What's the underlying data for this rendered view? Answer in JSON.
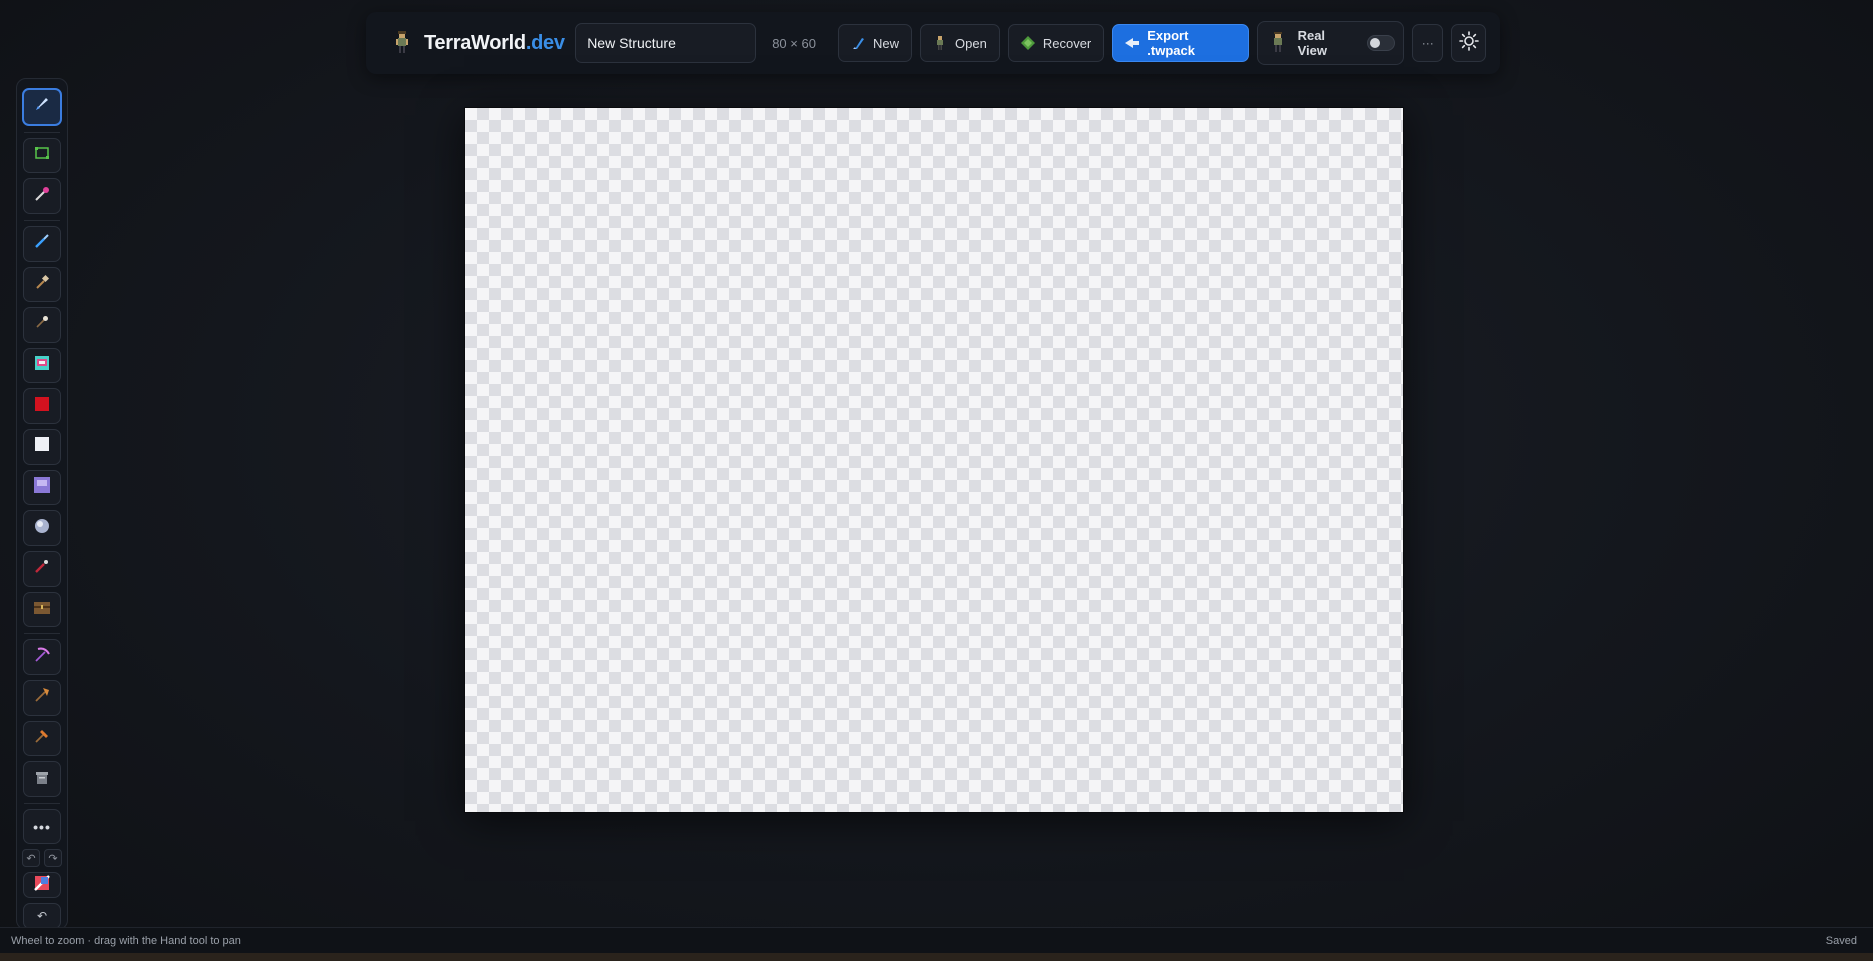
{
  "header": {
    "brand_main": "TerraWorld",
    "brand_suffix": ".dev",
    "structure_name": "New Structure",
    "dimensions": "80 × 60",
    "buttons": {
      "new": "New",
      "open": "Open",
      "recover": "Recover",
      "export": "Export .twpack",
      "real_view": "Real View",
      "more": "···"
    }
  },
  "toolbar": {
    "tools": [
      {
        "name": "pointer-tool",
        "icon": "rocket-icon"
      },
      {
        "name": "select-tool",
        "icon": "selection-rect-icon"
      },
      {
        "name": "eyedropper-tool",
        "icon": "wand-icon"
      },
      {
        "name": "paint-tool",
        "icon": "brush-icon"
      },
      {
        "name": "hammer-tool",
        "icon": "hammer-icon"
      },
      {
        "name": "wire-tool",
        "icon": "pin-icon"
      },
      {
        "name": "paint-bucket-tool",
        "icon": "bucket-icon"
      },
      {
        "name": "red-block-tool",
        "icon": "red-block-icon"
      },
      {
        "name": "white-block-tool",
        "icon": "white-block-icon"
      },
      {
        "name": "purple-block-tool",
        "icon": "purple-block-icon"
      },
      {
        "name": "sphere-tool",
        "icon": "sphere-icon"
      },
      {
        "name": "wand-red-tool",
        "icon": "rod-icon"
      },
      {
        "name": "chest-tool",
        "icon": "chest-icon"
      },
      {
        "name": "pickaxe-tool",
        "icon": "pickaxe-icon"
      },
      {
        "name": "axe-tool",
        "icon": "axe-icon"
      },
      {
        "name": "hammer2-tool",
        "icon": "hammer-icon"
      },
      {
        "name": "bucket-tool",
        "icon": "trash-icon"
      }
    ],
    "more": "•••",
    "undo": "↶",
    "redo": "↷",
    "reset": "↶"
  },
  "status": {
    "hint": "Wheel to zoom · drag with the Hand tool to pan",
    "save_state": "Saved"
  },
  "colors": {
    "accent": "#1d6fe0",
    "background": "#14171d"
  }
}
